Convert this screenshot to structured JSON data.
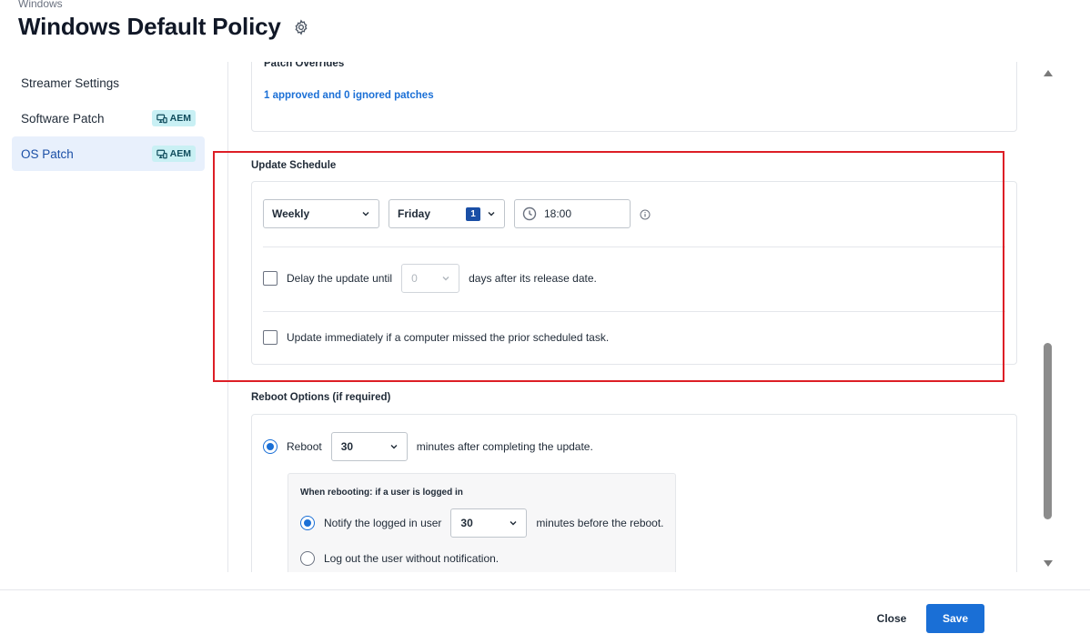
{
  "header": {
    "breadcrumb": "Windows",
    "title": "Windows Default Policy",
    "settings_icon": "gear-icon"
  },
  "sidebar": {
    "items": [
      {
        "label": "Streamer Settings",
        "badge": "",
        "active": false
      },
      {
        "label": "Software Patch",
        "badge": "AEM",
        "active": false
      },
      {
        "label": "OS Patch",
        "badge": "AEM",
        "active": true
      }
    ]
  },
  "patch_overrides": {
    "heading": "Patch Overrides",
    "link": "1 approved and 0 ignored patches"
  },
  "update_schedule": {
    "title": "Update Schedule",
    "frequency": "Weekly",
    "day": "Friday",
    "day_count": "1",
    "time": "18:00",
    "delay": {
      "label_before": "Delay the update until",
      "value": "0",
      "label_after": "days after its release date."
    },
    "missed_task_label": "Update immediately if a computer missed the prior scheduled task."
  },
  "reboot_options": {
    "title": "Reboot Options (if required)",
    "reboot_label": "Reboot",
    "reboot_minutes": "30",
    "reboot_suffix": "minutes after completing the update.",
    "sub_heading": "When rebooting: if a user is logged in",
    "notify_label": "Notify the logged in user",
    "notify_minutes": "30",
    "notify_suffix": "minutes before the reboot.",
    "logout_label": "Log out the user without notification."
  },
  "footer": {
    "close_label": "Close",
    "save_label": "Save"
  },
  "colors": {
    "accent": "#1a6fd6",
    "highlight": "#dd1e26",
    "badge_bg": "#c9f0f4"
  }
}
